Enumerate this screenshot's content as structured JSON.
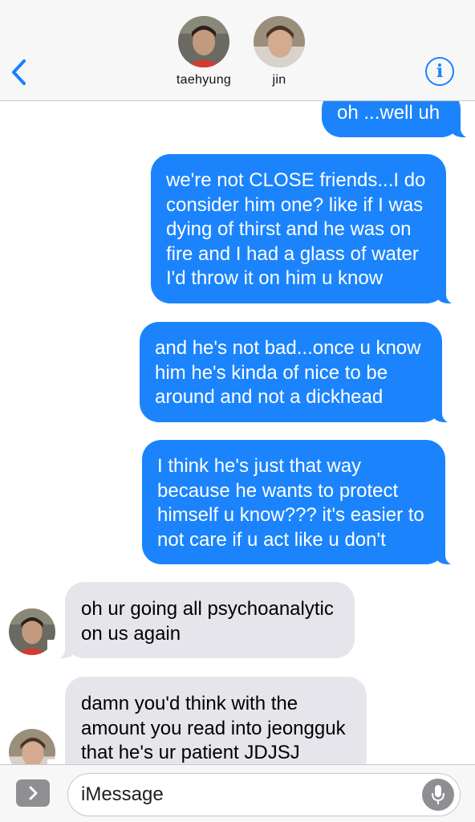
{
  "header": {
    "contacts": [
      {
        "name": "taehyung"
      },
      {
        "name": "jin"
      }
    ],
    "back_icon": "chevron-left-icon",
    "info_icon": "info-icon"
  },
  "messages": [
    {
      "from": "me",
      "lines": [
        "oh ...well uh"
      ]
    },
    {
      "from": "me",
      "lines": [
        "we're not CLOSE friends...I do",
        "consider him one? like if I was",
        "dying of thirst and he was on",
        "fire and I had a glass of water",
        "I'd throw it on him u know"
      ]
    },
    {
      "from": "me",
      "lines": [
        "and he's not bad...once u know",
        "him he's kinda of nice to be",
        "around and not a dickhead"
      ]
    },
    {
      "from": "me",
      "lines": [
        "I think he's just that way",
        "because he wants to protect",
        "himself u know??? it's easier to",
        "not care if u act like u don't"
      ]
    },
    {
      "from": "taehyung",
      "lines": [
        "oh ur going all psychoanalytic",
        "on us again"
      ]
    },
    {
      "from": "jin",
      "lines": [
        "damn you'd think with the",
        "amount you read into jeongguk",
        "that he's ur patient JDJSJ"
      ]
    }
  ],
  "input": {
    "placeholder": "iMessage"
  },
  "colors": {
    "accent": "#1a82fb",
    "outgoing_bubble": "#1b84fc",
    "incoming_bubble": "#e6e5eb"
  }
}
